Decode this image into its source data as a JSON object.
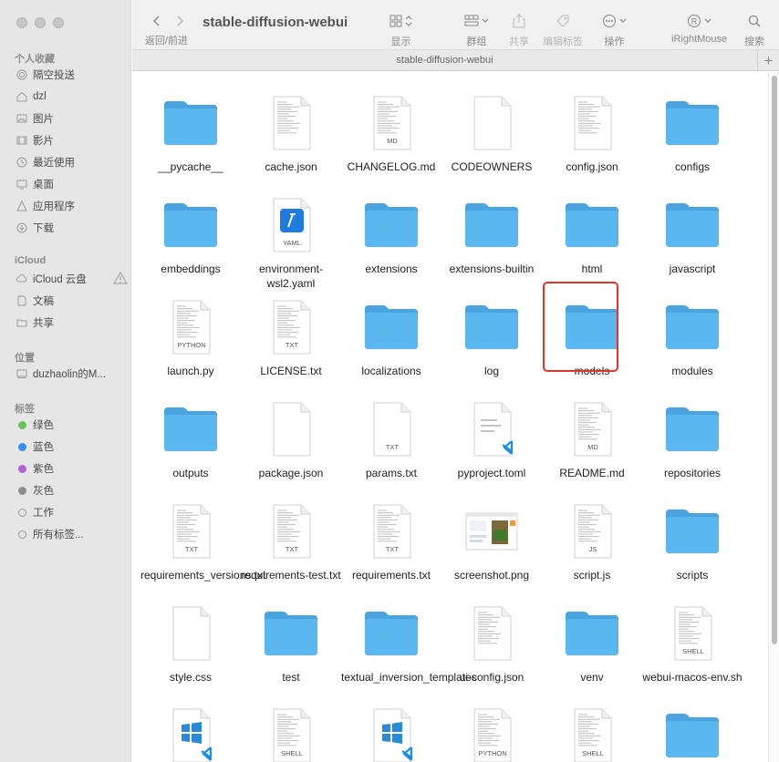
{
  "window": {
    "title": "stable-diffusion-webui"
  },
  "toolbar": {
    "nav_label": "返回/前进",
    "display_label": "显示",
    "group_label": "群组",
    "share_label": "共享",
    "tags_label": "编辑标签",
    "action_label": "操作",
    "irightmouse_label": "iRightMouse",
    "search_label": "搜索"
  },
  "pathbar": {
    "path": "stable-diffusion-webui",
    "plus": "+"
  },
  "sidebar": {
    "favorites_title": "个人收藏",
    "favorites": [
      {
        "label": "隔空投送",
        "icon": "airdrop-icon"
      },
      {
        "label": "dzl",
        "icon": "home-icon"
      },
      {
        "label": "图片",
        "icon": "pictures-icon"
      },
      {
        "label": "影片",
        "icon": "movies-icon"
      },
      {
        "label": "最近使用",
        "icon": "recents-icon"
      },
      {
        "label": "桌面",
        "icon": "desktop-icon"
      },
      {
        "label": "应用程序",
        "icon": "applications-icon"
      },
      {
        "label": "下载",
        "icon": "downloads-icon"
      }
    ],
    "icloud_title": "iCloud",
    "icloud": [
      {
        "label": "iCloud 云盘",
        "icon": "cloud-icon"
      },
      {
        "label": "文稿",
        "icon": "document-icon"
      },
      {
        "label": "共享",
        "icon": "shared-folder-icon"
      }
    ],
    "locations_title": "位置",
    "locations": [
      {
        "label": "duzhaolin的M...",
        "icon": "computer-icon"
      }
    ],
    "tags_title": "标签",
    "tags": [
      {
        "label": "绿色",
        "color": "#62c554"
      },
      {
        "label": "蓝色",
        "color": "#3a8ef0"
      },
      {
        "label": "紫色",
        "color": "#b05fd6"
      },
      {
        "label": "灰色",
        "color": "#8e8e8e"
      },
      {
        "label": "工作",
        "color": ""
      },
      {
        "label": "所有标签...",
        "color": ""
      }
    ]
  },
  "files": [
    {
      "name": "__pycache__",
      "kind": "folder"
    },
    {
      "name": "cache.json",
      "kind": "doc",
      "badge": ""
    },
    {
      "name": "CHANGELOG.md",
      "kind": "doc",
      "badge": "MD"
    },
    {
      "name": "CODEOWNERS",
      "kind": "blank",
      "badge": ""
    },
    {
      "name": "config.json",
      "kind": "doc",
      "badge": ""
    },
    {
      "name": "configs",
      "kind": "folder"
    },
    {
      "name": "embeddings",
      "kind": "folder"
    },
    {
      "name": "environment-wsl2.yaml",
      "kind": "yaml",
      "badge": "YAML"
    },
    {
      "name": "extensions",
      "kind": "folder"
    },
    {
      "name": "extensions-builtin",
      "kind": "folder"
    },
    {
      "name": "html",
      "kind": "folder"
    },
    {
      "name": "javascript",
      "kind": "folder"
    },
    {
      "name": "launch.py",
      "kind": "doc",
      "badge": "PYTHON"
    },
    {
      "name": "LICENSE.txt",
      "kind": "doc",
      "badge": "TXT"
    },
    {
      "name": "localizations",
      "kind": "folder"
    },
    {
      "name": "log",
      "kind": "folder"
    },
    {
      "name": "models",
      "kind": "folder",
      "selected": true
    },
    {
      "name": "modules",
      "kind": "folder"
    },
    {
      "name": "outputs",
      "kind": "folder"
    },
    {
      "name": "package.json",
      "kind": "blank",
      "badge": ""
    },
    {
      "name": "params.txt",
      "kind": "blank",
      "badge": "TXT"
    },
    {
      "name": "pyproject.toml",
      "kind": "vscode",
      "badge": ""
    },
    {
      "name": "README.md",
      "kind": "doc",
      "badge": "MD"
    },
    {
      "name": "repositories",
      "kind": "folder"
    },
    {
      "name": "requirements_versions.txt",
      "kind": "doc",
      "badge": "TXT"
    },
    {
      "name": "requirements-test.txt",
      "kind": "doc",
      "badge": "TXT"
    },
    {
      "name": "requirements.txt",
      "kind": "doc",
      "badge": "TXT"
    },
    {
      "name": "screenshot.png",
      "kind": "image",
      "badge": ""
    },
    {
      "name": "script.js",
      "kind": "doc",
      "badge": "JS"
    },
    {
      "name": "scripts",
      "kind": "folder"
    },
    {
      "name": "style.css",
      "kind": "blank",
      "badge": ""
    },
    {
      "name": "test",
      "kind": "folder"
    },
    {
      "name": "textual_inversion_templates",
      "kind": "folder"
    },
    {
      "name": "ui-config.json",
      "kind": "doc",
      "badge": ""
    },
    {
      "name": "venv",
      "kind": "folder"
    },
    {
      "name": "webui-macos-env.sh",
      "kind": "doc",
      "badge": "SHELL"
    },
    {
      "name": "",
      "kind": "windows",
      "badge": ""
    },
    {
      "name": "",
      "kind": "doc",
      "badge": "SHELL"
    },
    {
      "name": "",
      "kind": "windows",
      "badge": ""
    },
    {
      "name": "",
      "kind": "doc",
      "badge": "PYTHON"
    },
    {
      "name": "",
      "kind": "doc",
      "badge": "SHELL"
    },
    {
      "name": "",
      "kind": "folder"
    }
  ],
  "colors": {
    "folder": "#5ab7ef",
    "folder_tab": "#4aa4e0",
    "selection": "#e0352b"
  }
}
